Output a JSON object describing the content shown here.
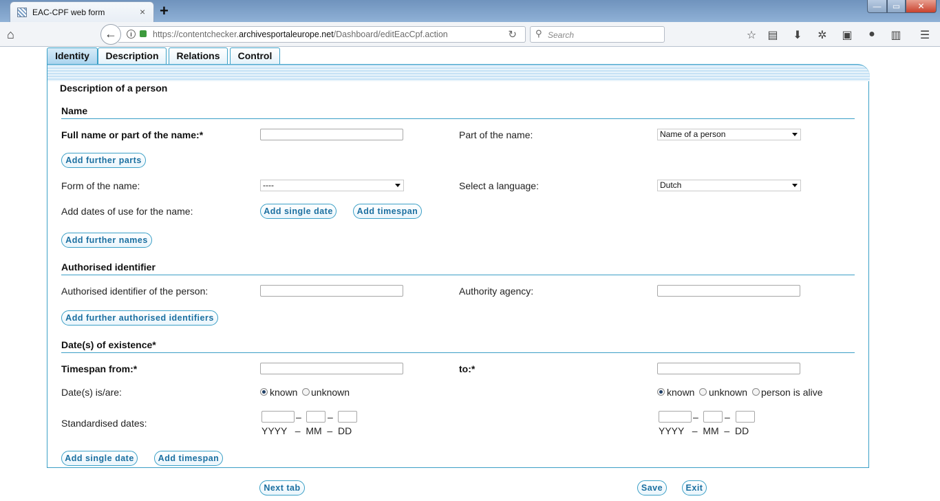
{
  "browser": {
    "tab_title": "EAC-CPF web form",
    "tab_close": "×",
    "new_tab": "+",
    "url_host": "https://contentchecker.",
    "url_domain": "archivesportaleurope.net",
    "url_path": "/Dashboard/editEacCpf.action",
    "search_placeholder": "Search",
    "window_min": "—",
    "window_max": "▭",
    "window_close": "✕"
  },
  "tabs": [
    "Identity",
    "Description",
    "Relations",
    "Control"
  ],
  "form": {
    "heading": "Description of a person",
    "name_section": {
      "title": "Name",
      "full_name_label": "Full name or part of the name:*",
      "part_label": "Part of the name:",
      "part_value": "Name of a person",
      "add_parts": "Add further parts",
      "form_label": "Form of the name:",
      "form_value": "----",
      "language_label": "Select a language:",
      "language_value": "Dutch",
      "dates_label": "Add dates of use for the name:",
      "add_single_date": "Add single date",
      "add_timespan": "Add timespan",
      "add_names": "Add further names"
    },
    "identifier_section": {
      "title": "Authorised identifier",
      "identifier_label": "Authorised identifier of the person:",
      "agency_label": "Authority agency:",
      "add_identifiers": "Add further authorised identifiers"
    },
    "existence_section": {
      "title": "Date(s) of existence*",
      "from_label": "Timespan from:*",
      "to_label": "to:*",
      "dates_are_label": "Date(s) is/are:",
      "known": "known",
      "unknown": "unknown",
      "alive": "person is alive",
      "standardised_label": "Standardised dates:",
      "dash": "–",
      "format": "YYYY   –  MM  –  DD",
      "add_single_date": "Add single date",
      "add_timespan": "Add timespan"
    }
  },
  "footer": {
    "next_tab": "Next tab",
    "save": "Save",
    "exit": "Exit"
  }
}
